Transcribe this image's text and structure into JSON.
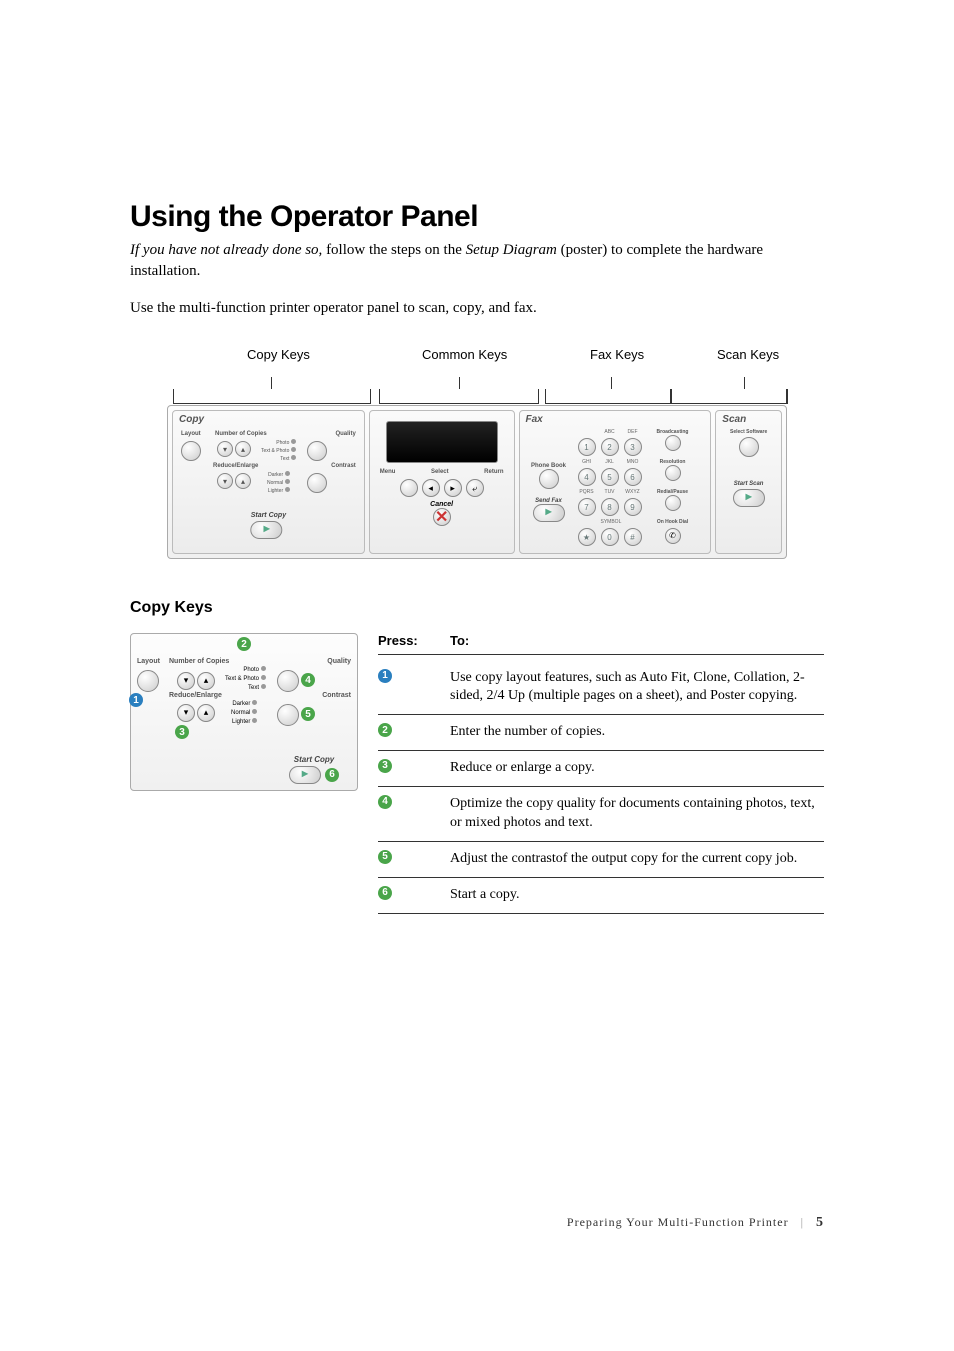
{
  "heading": "Using the Operator Panel",
  "intro_italic1": "If you have not already done so,",
  "intro_text1": " follow the steps on the ",
  "intro_italic2": "Setup Diagram",
  "intro_text2": " (poster) to complete the hardware installation.",
  "intro2": "Use the multi-function printer operator panel to scan, copy, and fax.",
  "diagram": {
    "groups": {
      "copy": "Copy Keys",
      "common": "Common Keys",
      "fax": "Fax Keys",
      "scan": "Scan Keys"
    },
    "copy": {
      "title": "Copy",
      "layout": "Layout",
      "num_copies": "Number of Copies",
      "quality": "Quality",
      "quality_opts": [
        "Photo",
        "Text & Photo",
        "Text"
      ],
      "reduce_enlarge": "Reduce/Enlarge",
      "contrast": "Contrast",
      "contrast_opts": [
        "Darker",
        "Normal",
        "Lighter"
      ],
      "start": "Start Copy"
    },
    "common": {
      "menu": "Menu",
      "select": "Select",
      "return": "Return",
      "cancel": "Cancel"
    },
    "fax": {
      "title": "Fax",
      "phone_book": "Phone Book",
      "send_fax": "Send Fax",
      "keypad_labels": [
        "",
        "ABC",
        "DEF",
        "GHI",
        "JKL",
        "MNO",
        "PQRS",
        "TUV",
        "WXYZ",
        "",
        "SYMBOL",
        ""
      ],
      "keypad_keys": [
        "1",
        "2",
        "3",
        "4",
        "5",
        "6",
        "7",
        "8",
        "9",
        "★",
        "0",
        "#"
      ],
      "right": [
        "Broadcasting",
        "Resolution",
        "Redial/Pause",
        "On Hook Dial"
      ]
    },
    "scan": {
      "title": "Scan",
      "select_software": "Select Software",
      "start_scan": "Start Scan"
    }
  },
  "copykeys_heading": "Copy Keys",
  "subpanel": {
    "layout": "Layout",
    "num_copies": "Number of Copies",
    "quality": "Quality",
    "quality_opts": [
      "Photo",
      "Text & Photo",
      "Text"
    ],
    "reduce_enlarge": "Reduce/Enlarge",
    "contrast": "Contrast",
    "contrast_opts": [
      "Darker",
      "Normal",
      "Lighter"
    ],
    "start": "Start Copy"
  },
  "table": {
    "header_press": "Press:",
    "header_to": "To:",
    "rows": [
      {
        "num": "1",
        "color": "blue",
        "to": "Use copy layout features, such as Auto Fit, Clone, Collation, 2-sided, 2/4 Up (multiple pages on a sheet), and Poster copying."
      },
      {
        "num": "2",
        "color": "green",
        "to": "Enter the number of copies."
      },
      {
        "num": "3",
        "color": "green",
        "to": "Reduce or enlarge a copy."
      },
      {
        "num": "4",
        "color": "green",
        "to": "Optimize the copy quality for documents containing photos, text, or mixed photos and text."
      },
      {
        "num": "5",
        "color": "green",
        "to": "Adjust the contrastof the output copy for the current copy job."
      },
      {
        "num": "6",
        "color": "green",
        "to": "Start a copy."
      }
    ]
  },
  "footer": {
    "text": "Preparing Your Multi-Function Printer",
    "page": "5"
  }
}
